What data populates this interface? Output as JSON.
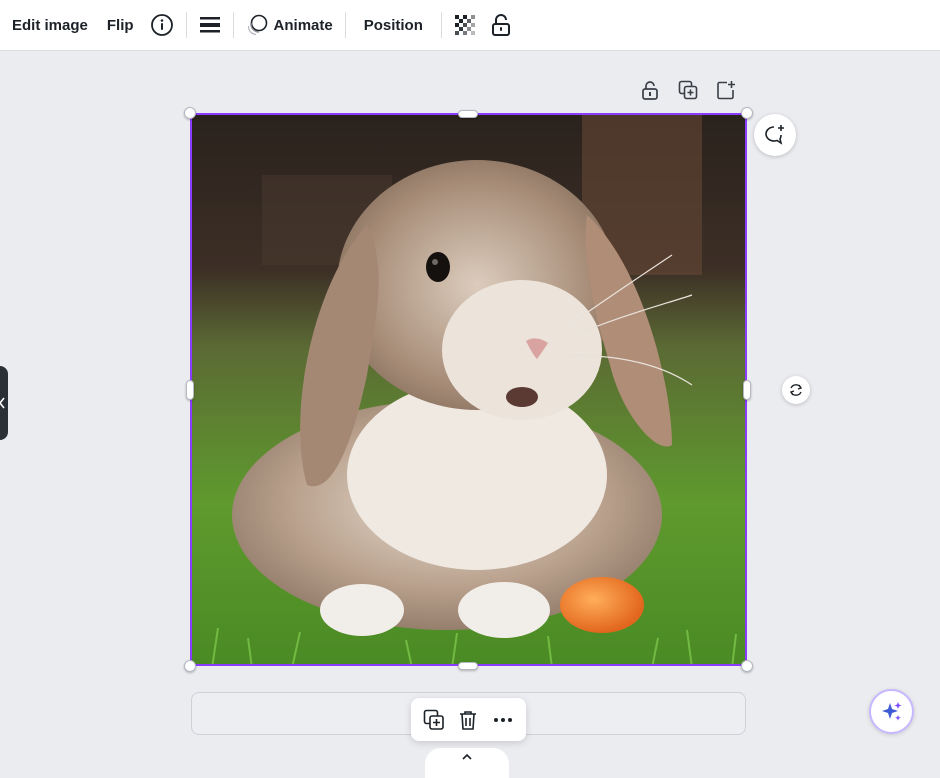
{
  "toolbar": {
    "edit_image": "Edit image",
    "flip": "Flip",
    "info_icon": "info-icon",
    "spacing_icon": "line-spacing-icon",
    "animate": "Animate",
    "position": "Position",
    "transparency_icon": "transparency-icon",
    "lock_icon": "lock-icon"
  },
  "page_actions": {
    "icons": [
      "lock-page-icon",
      "duplicate-page-icon",
      "add-page-icon"
    ]
  },
  "canvas": {
    "image_subject": "lop-eared rabbit on grass with a carrot",
    "selection_color": "#8b3dff"
  },
  "floating_toolbar": {
    "icons": [
      "duplicate-icon",
      "trash-icon",
      "more-icon"
    ]
  },
  "side_buttons": {
    "comment": "add-comment-icon",
    "rotate": "rotate-icon",
    "magic": "magic-sparkle-icon"
  },
  "colors": {
    "accent": "#8b3dff",
    "background": "#ebecf0",
    "toolbar_bg": "#ffffff"
  }
}
